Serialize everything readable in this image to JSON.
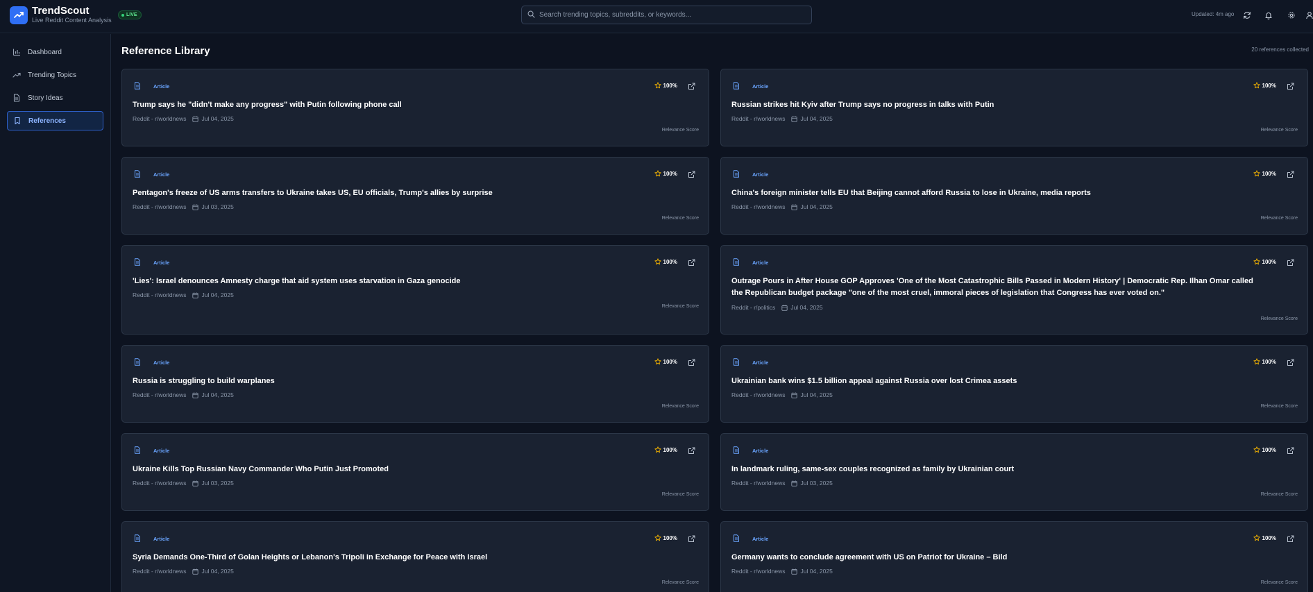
{
  "app": {
    "name": "TrendScout",
    "subtitle": "Live Reddit Content Analysis",
    "live_label": "LIVE"
  },
  "colors": {
    "background": "#0d1320",
    "card": "#1a2231",
    "accent": "#2f6ff5",
    "live": "#33d17a",
    "star": "#f5b400"
  },
  "header": {
    "search_placeholder": "Search trending topics, subreddits, or keywords...",
    "updated": "Updated: 4m ago",
    "icons": [
      "refresh-icon",
      "bell-icon",
      "gear-icon",
      "user-icon"
    ]
  },
  "sidebar": {
    "items": [
      {
        "label": "Dashboard",
        "icon": "bar-chart-icon"
      },
      {
        "label": "Trending Topics",
        "icon": "trending-up-icon"
      },
      {
        "label": "Story Ideas",
        "icon": "document-icon"
      },
      {
        "label": "References",
        "icon": "bookmark-icon",
        "active": true
      }
    ]
  },
  "main": {
    "title": "Reference Library",
    "count": "20 references collected",
    "relevance_label": "Relevance Score",
    "cards": [
      {
        "type": "Article",
        "score": "100%",
        "title": "Trump says he \"didn't make any progress\" with Putin following phone call",
        "source": "Reddit - r/worldnews",
        "date": "Jul 04, 2025"
      },
      {
        "type": "Article",
        "score": "100%",
        "title": "Russian strikes hit Kyiv after Trump says no progress in talks with Putin",
        "source": "Reddit - r/worldnews",
        "date": "Jul 04, 2025"
      },
      {
        "type": "Article",
        "score": "100%",
        "title": "Pentagon's freeze of US arms transfers to Ukraine takes US, EU officials, Trump's allies by surprise",
        "source": "Reddit - r/worldnews",
        "date": "Jul 03, 2025"
      },
      {
        "type": "Article",
        "score": "100%",
        "title": "China's foreign minister tells EU that Beijing cannot afford Russia to lose in Ukraine, media reports",
        "source": "Reddit - r/worldnews",
        "date": "Jul 04, 2025"
      },
      {
        "type": "Article",
        "score": "100%",
        "title": "'Lies': Israel denounces Amnesty charge that aid system uses starvation in Gaza genocide",
        "source": "Reddit - r/worldnews",
        "date": "Jul 04, 2025"
      },
      {
        "type": "Article",
        "score": "100%",
        "title": "Outrage Pours in After House GOP Approves 'One of the Most Catastrophic Bills Passed in Modern History' | Democratic Rep. Ilhan Omar called the Republican budget package \"one of the most cruel, immoral pieces of legislation that Congress has ever voted on.\"",
        "source": "Reddit - r/politics",
        "date": "Jul 04, 2025"
      },
      {
        "type": "Article",
        "score": "100%",
        "title": "Russia is struggling to build warplanes",
        "source": "Reddit - r/worldnews",
        "date": "Jul 04, 2025"
      },
      {
        "type": "Article",
        "score": "100%",
        "title": "Ukrainian bank wins $1.5 billion appeal against Russia over lost Crimea assets",
        "source": "Reddit - r/worldnews",
        "date": "Jul 04, 2025"
      },
      {
        "type": "Article",
        "score": "100%",
        "title": "Ukraine Kills Top Russian Navy Commander Who Putin Just Promoted",
        "source": "Reddit - r/worldnews",
        "date": "Jul 03, 2025"
      },
      {
        "type": "Article",
        "score": "100%",
        "title": "In landmark ruling, same-sex couples recognized as family by Ukrainian court",
        "source": "Reddit - r/worldnews",
        "date": "Jul 03, 2025"
      },
      {
        "type": "Article",
        "score": "100%",
        "title": "Syria Demands One-Third of Golan Heights or Lebanon's Tripoli in Exchange for Peace with Israel",
        "source": "Reddit - r/worldnews",
        "date": "Jul 04, 2025"
      },
      {
        "type": "Article",
        "score": "100%",
        "title": "Germany wants to conclude agreement with US on Patriot for Ukraine – Bild",
        "source": "Reddit - r/worldnews",
        "date": "Jul 04, 2025"
      }
    ]
  }
}
